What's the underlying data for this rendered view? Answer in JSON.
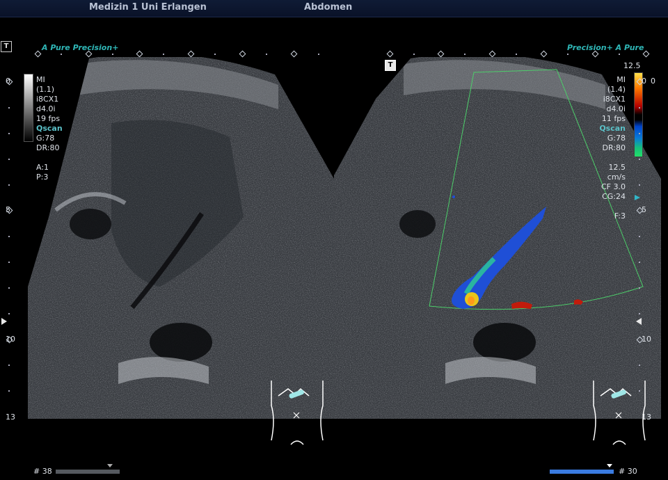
{
  "header": {
    "institution": "Medizin 1 Uni Erlangen",
    "exam": "Abdomen"
  },
  "left_panel": {
    "logo": {
      "a": "A",
      "pure": "Pure",
      "precision": "Precision",
      "plus": "+"
    },
    "params": [
      "MI",
      "(1.1)",
      "i8CX1",
      "d4.0i",
      "19 fps",
      "Qscan",
      "G:78",
      "DR:80",
      "",
      "A:1",
      "P:3"
    ],
    "depth_labels": [
      "0",
      "5",
      "10",
      "13"
    ],
    "frame": "# 38",
    "slider_fill": 0.0
  },
  "right_panel": {
    "logo": {
      "precision": "Precision",
      "plus": "+",
      "a": "A",
      "pure": "Pure"
    },
    "params": [
      "MI",
      "(1.4)",
      "i8CX1",
      "d4.0i",
      "11 fps",
      "Qscan",
      "G:78",
      "DR:80",
      "",
      "12.5",
      "cm/s",
      "CF 3.0",
      "CG:24",
      "",
      "F:3"
    ],
    "color_scale": {
      "top": "12.5",
      "zero": "0"
    },
    "depth_labels": [
      "0",
      "5",
      "10",
      "13"
    ],
    "frame": "# 30",
    "slider_fill": 1.0
  },
  "icons": {
    "t_left": "T",
    "t_right": "T"
  },
  "colors": {
    "logo": "#2fb6b6",
    "doppler_blue": "#1f4fd6",
    "doppler_red": "#c21b0b",
    "doppler_yellow": "#ffe04a"
  }
}
